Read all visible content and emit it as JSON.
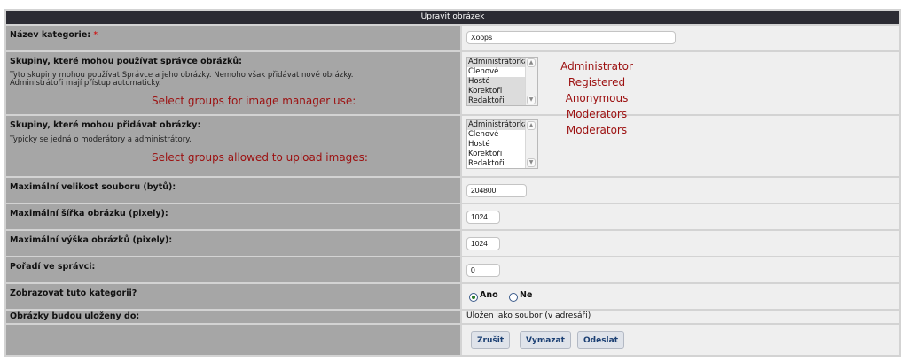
{
  "header": {
    "title": "Upravit obrázek"
  },
  "fields": {
    "name": {
      "label": "Název kategorie:",
      "required_mark": "*",
      "value": "Xoops"
    },
    "manager_groups": {
      "label": "Skupiny, které mohou používat správce obrázků:",
      "desc_line1": "Tyto skupiny mohou používat Správce a jeho obrázky. Nemoho však přidávat nové obrázky.",
      "desc_line2": "Administrátoři mají přístup automaticky.",
      "note": "Select groups for image manager use:",
      "options": [
        "Administrátorka",
        "Členové",
        "Hosté",
        "Korektoři",
        "Redaktoři"
      ]
    },
    "upload_groups": {
      "label": "Skupiny, které mohou přidávat obrázky:",
      "desc_line1": "Typicky se jedná o moderátory a administrátory.",
      "note": "Select groups allowed to upload images:",
      "options": [
        "Administrátorka",
        "Členové",
        "Hosté",
        "Korektoři",
        "Redaktoři"
      ]
    },
    "max_filesize": {
      "label": "Maximální velikost souboru (bytů):",
      "value": "204800"
    },
    "max_width": {
      "label": "Maximální šířka obrázku (pixely):",
      "value": "1024"
    },
    "max_height": {
      "label": "Maximální výška obrázků (pixely):",
      "value": "1024"
    },
    "order": {
      "label": "Pořadí ve správci:",
      "value": "0"
    },
    "display": {
      "label": "Zobrazovat tuto kategorii?",
      "yes": "Ano",
      "no": "Ne"
    },
    "storage": {
      "label": "Obrázky budou uloženy do:",
      "value": "Uložen jako soubor (v adresáři)"
    }
  },
  "annotations": [
    "Administrator",
    "Registered",
    "Anonymous",
    "Moderators",
    "Moderators"
  ],
  "buttons": {
    "cancel": "Zrušit",
    "clear": "Vymazat",
    "submit": "Odeslat"
  }
}
